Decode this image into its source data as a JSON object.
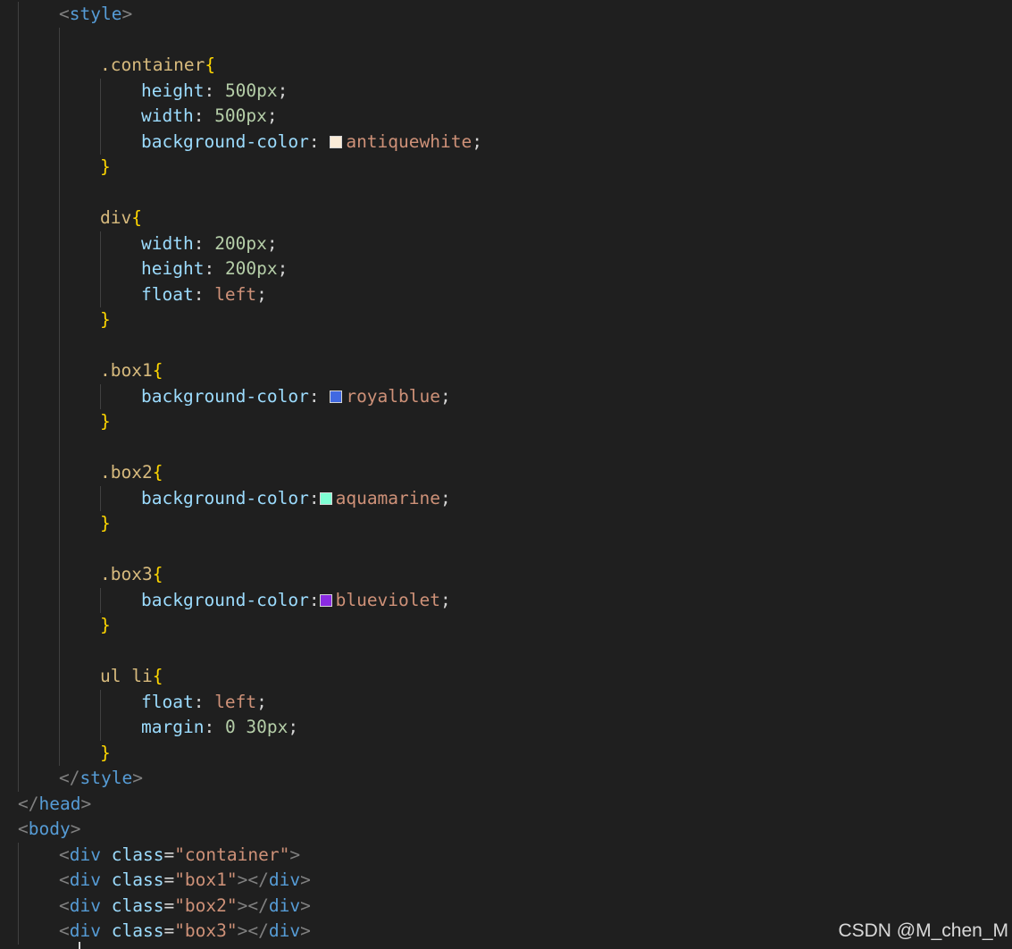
{
  "editor": {
    "lines": [
      {
        "indent": 1,
        "tokens": [
          {
            "t": "<",
            "c": "k-punct"
          },
          {
            "t": "style",
            "c": "k-tag"
          },
          {
            "t": ">",
            "c": "k-punct"
          }
        ]
      },
      {
        "indent": 0,
        "tokens": []
      },
      {
        "indent": 2,
        "tokens": [
          {
            "t": ".container",
            "c": "k-sel"
          },
          {
            "t": "{",
            "c": "k-brace"
          }
        ]
      },
      {
        "indent": 3,
        "tokens": [
          {
            "t": "height",
            "c": "k-prop"
          },
          {
            "t": ": ",
            "c": "k-text"
          },
          {
            "t": "500px",
            "c": "k-num"
          },
          {
            "t": ";",
            "c": "k-text"
          }
        ]
      },
      {
        "indent": 3,
        "tokens": [
          {
            "t": "width",
            "c": "k-prop"
          },
          {
            "t": ": ",
            "c": "k-text"
          },
          {
            "t": "500px",
            "c": "k-num"
          },
          {
            "t": ";",
            "c": "k-text"
          }
        ]
      },
      {
        "indent": 3,
        "tokens": [
          {
            "t": "background-color",
            "c": "k-prop"
          },
          {
            "t": ": ",
            "c": "k-text"
          },
          {
            "swatch": "#faebd7",
            "name": "antiquewhite-swatch"
          },
          {
            "t": "antiquewhite",
            "c": "k-val"
          },
          {
            "t": ";",
            "c": "k-text"
          }
        ]
      },
      {
        "indent": 2,
        "tokens": [
          {
            "t": "}",
            "c": "k-brace"
          }
        ]
      },
      {
        "indent": 0,
        "tokens": []
      },
      {
        "indent": 2,
        "tokens": [
          {
            "t": "div",
            "c": "k-sel"
          },
          {
            "t": "{",
            "c": "k-brace"
          }
        ]
      },
      {
        "indent": 3,
        "tokens": [
          {
            "t": "width",
            "c": "k-prop"
          },
          {
            "t": ": ",
            "c": "k-text"
          },
          {
            "t": "200px",
            "c": "k-num"
          },
          {
            "t": ";",
            "c": "k-text"
          }
        ]
      },
      {
        "indent": 3,
        "tokens": [
          {
            "t": "height",
            "c": "k-prop"
          },
          {
            "t": ": ",
            "c": "k-text"
          },
          {
            "t": "200px",
            "c": "k-num"
          },
          {
            "t": ";",
            "c": "k-text"
          }
        ]
      },
      {
        "indent": 3,
        "tokens": [
          {
            "t": "float",
            "c": "k-prop"
          },
          {
            "t": ": ",
            "c": "k-text"
          },
          {
            "t": "left",
            "c": "k-val"
          },
          {
            "t": ";",
            "c": "k-text"
          }
        ]
      },
      {
        "indent": 2,
        "tokens": [
          {
            "t": "}",
            "c": "k-brace"
          }
        ]
      },
      {
        "indent": 0,
        "tokens": []
      },
      {
        "indent": 2,
        "tokens": [
          {
            "t": ".box1",
            "c": "k-sel"
          },
          {
            "t": "{",
            "c": "k-brace"
          }
        ]
      },
      {
        "indent": 3,
        "tokens": [
          {
            "t": "background-color",
            "c": "k-prop"
          },
          {
            "t": ": ",
            "c": "k-text"
          },
          {
            "swatch": "#4169e1",
            "name": "royalblue-swatch"
          },
          {
            "t": "royalblue",
            "c": "k-val"
          },
          {
            "t": ";",
            "c": "k-text"
          }
        ]
      },
      {
        "indent": 2,
        "tokens": [
          {
            "t": "}",
            "c": "k-brace"
          }
        ]
      },
      {
        "indent": 0,
        "tokens": []
      },
      {
        "indent": 2,
        "tokens": [
          {
            "t": ".box2",
            "c": "k-sel"
          },
          {
            "t": "{",
            "c": "k-brace"
          }
        ]
      },
      {
        "indent": 3,
        "tokens": [
          {
            "t": "background-color",
            "c": "k-prop"
          },
          {
            "t": ":",
            "c": "k-text"
          },
          {
            "swatch": "#7fffd4",
            "name": "aquamarine-swatch"
          },
          {
            "t": "aquamarine",
            "c": "k-val"
          },
          {
            "t": ";",
            "c": "k-text"
          }
        ]
      },
      {
        "indent": 2,
        "tokens": [
          {
            "t": "}",
            "c": "k-brace"
          }
        ]
      },
      {
        "indent": 0,
        "tokens": []
      },
      {
        "indent": 2,
        "tokens": [
          {
            "t": ".box3",
            "c": "k-sel"
          },
          {
            "t": "{",
            "c": "k-brace"
          }
        ]
      },
      {
        "indent": 3,
        "tokens": [
          {
            "t": "background-color",
            "c": "k-prop"
          },
          {
            "t": ":",
            "c": "k-text"
          },
          {
            "swatch": "#8a2be2",
            "name": "blueviolet-swatch"
          },
          {
            "t": "blueviolet",
            "c": "k-val"
          },
          {
            "t": ";",
            "c": "k-text"
          }
        ]
      },
      {
        "indent": 2,
        "tokens": [
          {
            "t": "}",
            "c": "k-brace"
          }
        ]
      },
      {
        "indent": 0,
        "tokens": []
      },
      {
        "indent": 2,
        "tokens": [
          {
            "t": "ul li",
            "c": "k-sel"
          },
          {
            "t": "{",
            "c": "k-brace"
          }
        ]
      },
      {
        "indent": 3,
        "tokens": [
          {
            "t": "float",
            "c": "k-prop"
          },
          {
            "t": ": ",
            "c": "k-text"
          },
          {
            "t": "left",
            "c": "k-val"
          },
          {
            "t": ";",
            "c": "k-text"
          }
        ]
      },
      {
        "indent": 3,
        "tokens": [
          {
            "t": "margin",
            "c": "k-prop"
          },
          {
            "t": ": ",
            "c": "k-text"
          },
          {
            "t": "0 30px",
            "c": "k-num"
          },
          {
            "t": ";",
            "c": "k-text"
          }
        ]
      },
      {
        "indent": 2,
        "tokens": [
          {
            "t": "}",
            "c": "k-brace"
          }
        ]
      },
      {
        "indent": 1,
        "tokens": [
          {
            "t": "</",
            "c": "k-punct"
          },
          {
            "t": "style",
            "c": "k-tag"
          },
          {
            "t": ">",
            "c": "k-punct"
          }
        ]
      },
      {
        "indent": 0,
        "tokens": [
          {
            "t": "</",
            "c": "k-punct"
          },
          {
            "t": "head",
            "c": "k-tag"
          },
          {
            "t": ">",
            "c": "k-punct"
          }
        ]
      },
      {
        "indent": 0,
        "tokens": [
          {
            "t": "<",
            "c": "k-punct"
          },
          {
            "t": "body",
            "c": "k-tag"
          },
          {
            "t": ">",
            "c": "k-punct"
          }
        ]
      },
      {
        "indent": 1,
        "tokens": [
          {
            "t": "<",
            "c": "k-punct"
          },
          {
            "t": "div",
            "c": "k-tag"
          },
          {
            "t": " ",
            "c": "k-text"
          },
          {
            "t": "class",
            "c": "k-attr"
          },
          {
            "t": "=",
            "c": "k-text"
          },
          {
            "t": "\"container\"",
            "c": "k-str"
          },
          {
            "t": ">",
            "c": "k-punct"
          }
        ]
      },
      {
        "indent": 1,
        "tokens": [
          {
            "t": "<",
            "c": "k-punct"
          },
          {
            "t": "div",
            "c": "k-tag"
          },
          {
            "t": " ",
            "c": "k-text"
          },
          {
            "t": "class",
            "c": "k-attr"
          },
          {
            "t": "=",
            "c": "k-text"
          },
          {
            "t": "\"box1\"",
            "c": "k-str"
          },
          {
            "t": "></",
            "c": "k-punct"
          },
          {
            "t": "div",
            "c": "k-tag"
          },
          {
            "t": ">",
            "c": "k-punct"
          }
        ]
      },
      {
        "indent": 1,
        "tokens": [
          {
            "t": "<",
            "c": "k-punct"
          },
          {
            "t": "div",
            "c": "k-tag"
          },
          {
            "t": " ",
            "c": "k-text"
          },
          {
            "t": "class",
            "c": "k-attr"
          },
          {
            "t": "=",
            "c": "k-text"
          },
          {
            "t": "\"box2\"",
            "c": "k-str"
          },
          {
            "t": "></",
            "c": "k-punct"
          },
          {
            "t": "div",
            "c": "k-tag"
          },
          {
            "t": ">",
            "c": "k-punct"
          }
        ]
      },
      {
        "indent": 1,
        "tokens": [
          {
            "t": "<",
            "c": "k-punct"
          },
          {
            "t": "div",
            "c": "k-tag"
          },
          {
            "t": " ",
            "c": "k-text"
          },
          {
            "t": "class",
            "c": "k-attr"
          },
          {
            "t": "=",
            "c": "k-text"
          },
          {
            "t": "\"box3\"",
            "c": "k-str"
          },
          {
            "t": "></",
            "c": "k-punct"
          },
          {
            "t": "div",
            "c": "k-tag"
          },
          {
            "t": ">",
            "c": "k-punct"
          }
        ]
      }
    ]
  },
  "watermark": "CSDN @M_chen_M",
  "colors": {
    "background": "#1f1f1f",
    "tag": "#569cd6",
    "selector": "#d7ba7d",
    "brace": "#ffd700",
    "property": "#9cdcfe",
    "number": "#b5cea8",
    "value": "#ce9178"
  }
}
